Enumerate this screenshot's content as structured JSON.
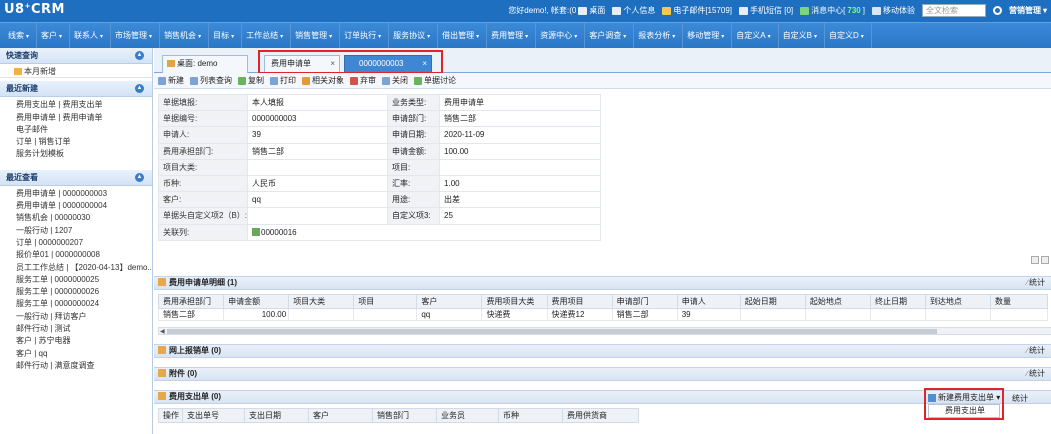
{
  "app": {
    "logo_text": "U8",
    "logo_sup": "+",
    "logo_suffix": "CRM"
  },
  "topbar": {
    "greeting": "您好demo!, 帐套:(0",
    "desktop": "桌面",
    "personal_info": "个人信息",
    "email": "电子邮件[15709]",
    "sms": "手机短信 [0]",
    "message_center": "消息中心[",
    "message_count": "730",
    "message_close": "]",
    "mobile_exp": "移动体验",
    "search_placeholder": "全文检索",
    "user_menu": "营销管理"
  },
  "menu": [
    "线索",
    "客户",
    "联系人",
    "市场管理",
    "销售机会",
    "目标",
    "工作总结",
    "销售管理",
    "订单执行",
    "服务协议",
    "借出管理",
    "费用管理",
    "资源中心",
    "客户调查",
    "报表分析",
    "移动管理",
    "自定义A",
    "自定义B",
    "自定义D"
  ],
  "sidebar": {
    "quick_title": "快速查询",
    "quick_items": [
      "本月新增"
    ],
    "recent_new_title": "最近新建",
    "recent_new_items": [
      "费用支出单 | 费用支出单",
      "费用申请单 | 费用申请单",
      "电子邮件",
      "订单 | 销售订单",
      "服务计划模板"
    ],
    "recent_view_title": "最近查看",
    "recent_view_items": [
      "费用申请单 | 0000000003",
      "费用申请单 | 0000000004",
      "销售机会 | 00000030",
      "一般行动 | 1207",
      "订单 | 0000000207",
      "报价单01 | 0000000008",
      "员工工作总结 | 【2020-04-13】demo...",
      "服务工单 | 0000000025",
      "服务工单 | 0000000026",
      "服务工单 | 0000000024",
      "一般行动 | 拜访客户",
      "邮件行动 | 测试",
      "客户 | 苏宁电器",
      "客户 | qq",
      "邮件行动 | 满意度调查"
    ]
  },
  "tabs": {
    "home": "桌面: demo",
    "t1": "费用申请单",
    "t2": "0000000003",
    "close": "×"
  },
  "toolbar": [
    "新建",
    "列表查询",
    "复制",
    "打印",
    "相关对象",
    "弃审",
    "关闭",
    "单据讨论"
  ],
  "form": {
    "rows": [
      [
        "单据填报:",
        "本人填报",
        "业务类型:",
        "费用申请单"
      ],
      [
        "单据编号:",
        "0000000003",
        "申请部门:",
        "销售二部"
      ],
      [
        "申请人:",
        "39",
        "申请日期:",
        "2020-11-09"
      ],
      [
        "费用承担部门:",
        "销售二部",
        "申请金额:",
        "100.00"
      ],
      [
        "项目大类:",
        "",
        "项目:",
        ""
      ],
      [
        "币种:",
        "人民币",
        "汇率:",
        "1.00"
      ],
      [
        "客户:",
        "qq",
        "用途:",
        "出差"
      ],
      [
        "单据头自定义项2（B）:",
        "",
        "自定义项3:",
        "25"
      ]
    ],
    "related_label": "关联列:",
    "related_value": "00000016"
  },
  "sections": {
    "detail": "费用申请单明细 (1)",
    "reimburse": "网上报销单 (0)",
    "attach": "附件 (0)",
    "expense": "费用支出单 (0)",
    "stat": "统计"
  },
  "detail_grid": {
    "headers": [
      "费用承担部门",
      "申请金额",
      "项目大类",
      "项目",
      "客户",
      "费用项目大类",
      "费用项目",
      "申请部门",
      "申请人",
      "起始日期",
      "起始地点",
      "终止日期",
      "到达地点",
      "数量"
    ],
    "rows": [
      [
        "销售二部",
        "100.00",
        "",
        "",
        "qq",
        "快递费",
        "快递费12",
        "销售二部",
        "39",
        "",
        "",
        "",
        "",
        ""
      ]
    ]
  },
  "expense_grid": {
    "headers": [
      "操作",
      "支出单号",
      "支出日期",
      "客户",
      "销售部门",
      "业务员",
      "币种",
      "费用供货商"
    ]
  },
  "expense_actions": {
    "new_button": "新建费用支出单",
    "dropdown_item": "费用支出单"
  },
  "colors": {
    "header_blue": "#1f6fc0",
    "highlight_red": "#e0252a",
    "active_tab": "#3f87d2"
  }
}
